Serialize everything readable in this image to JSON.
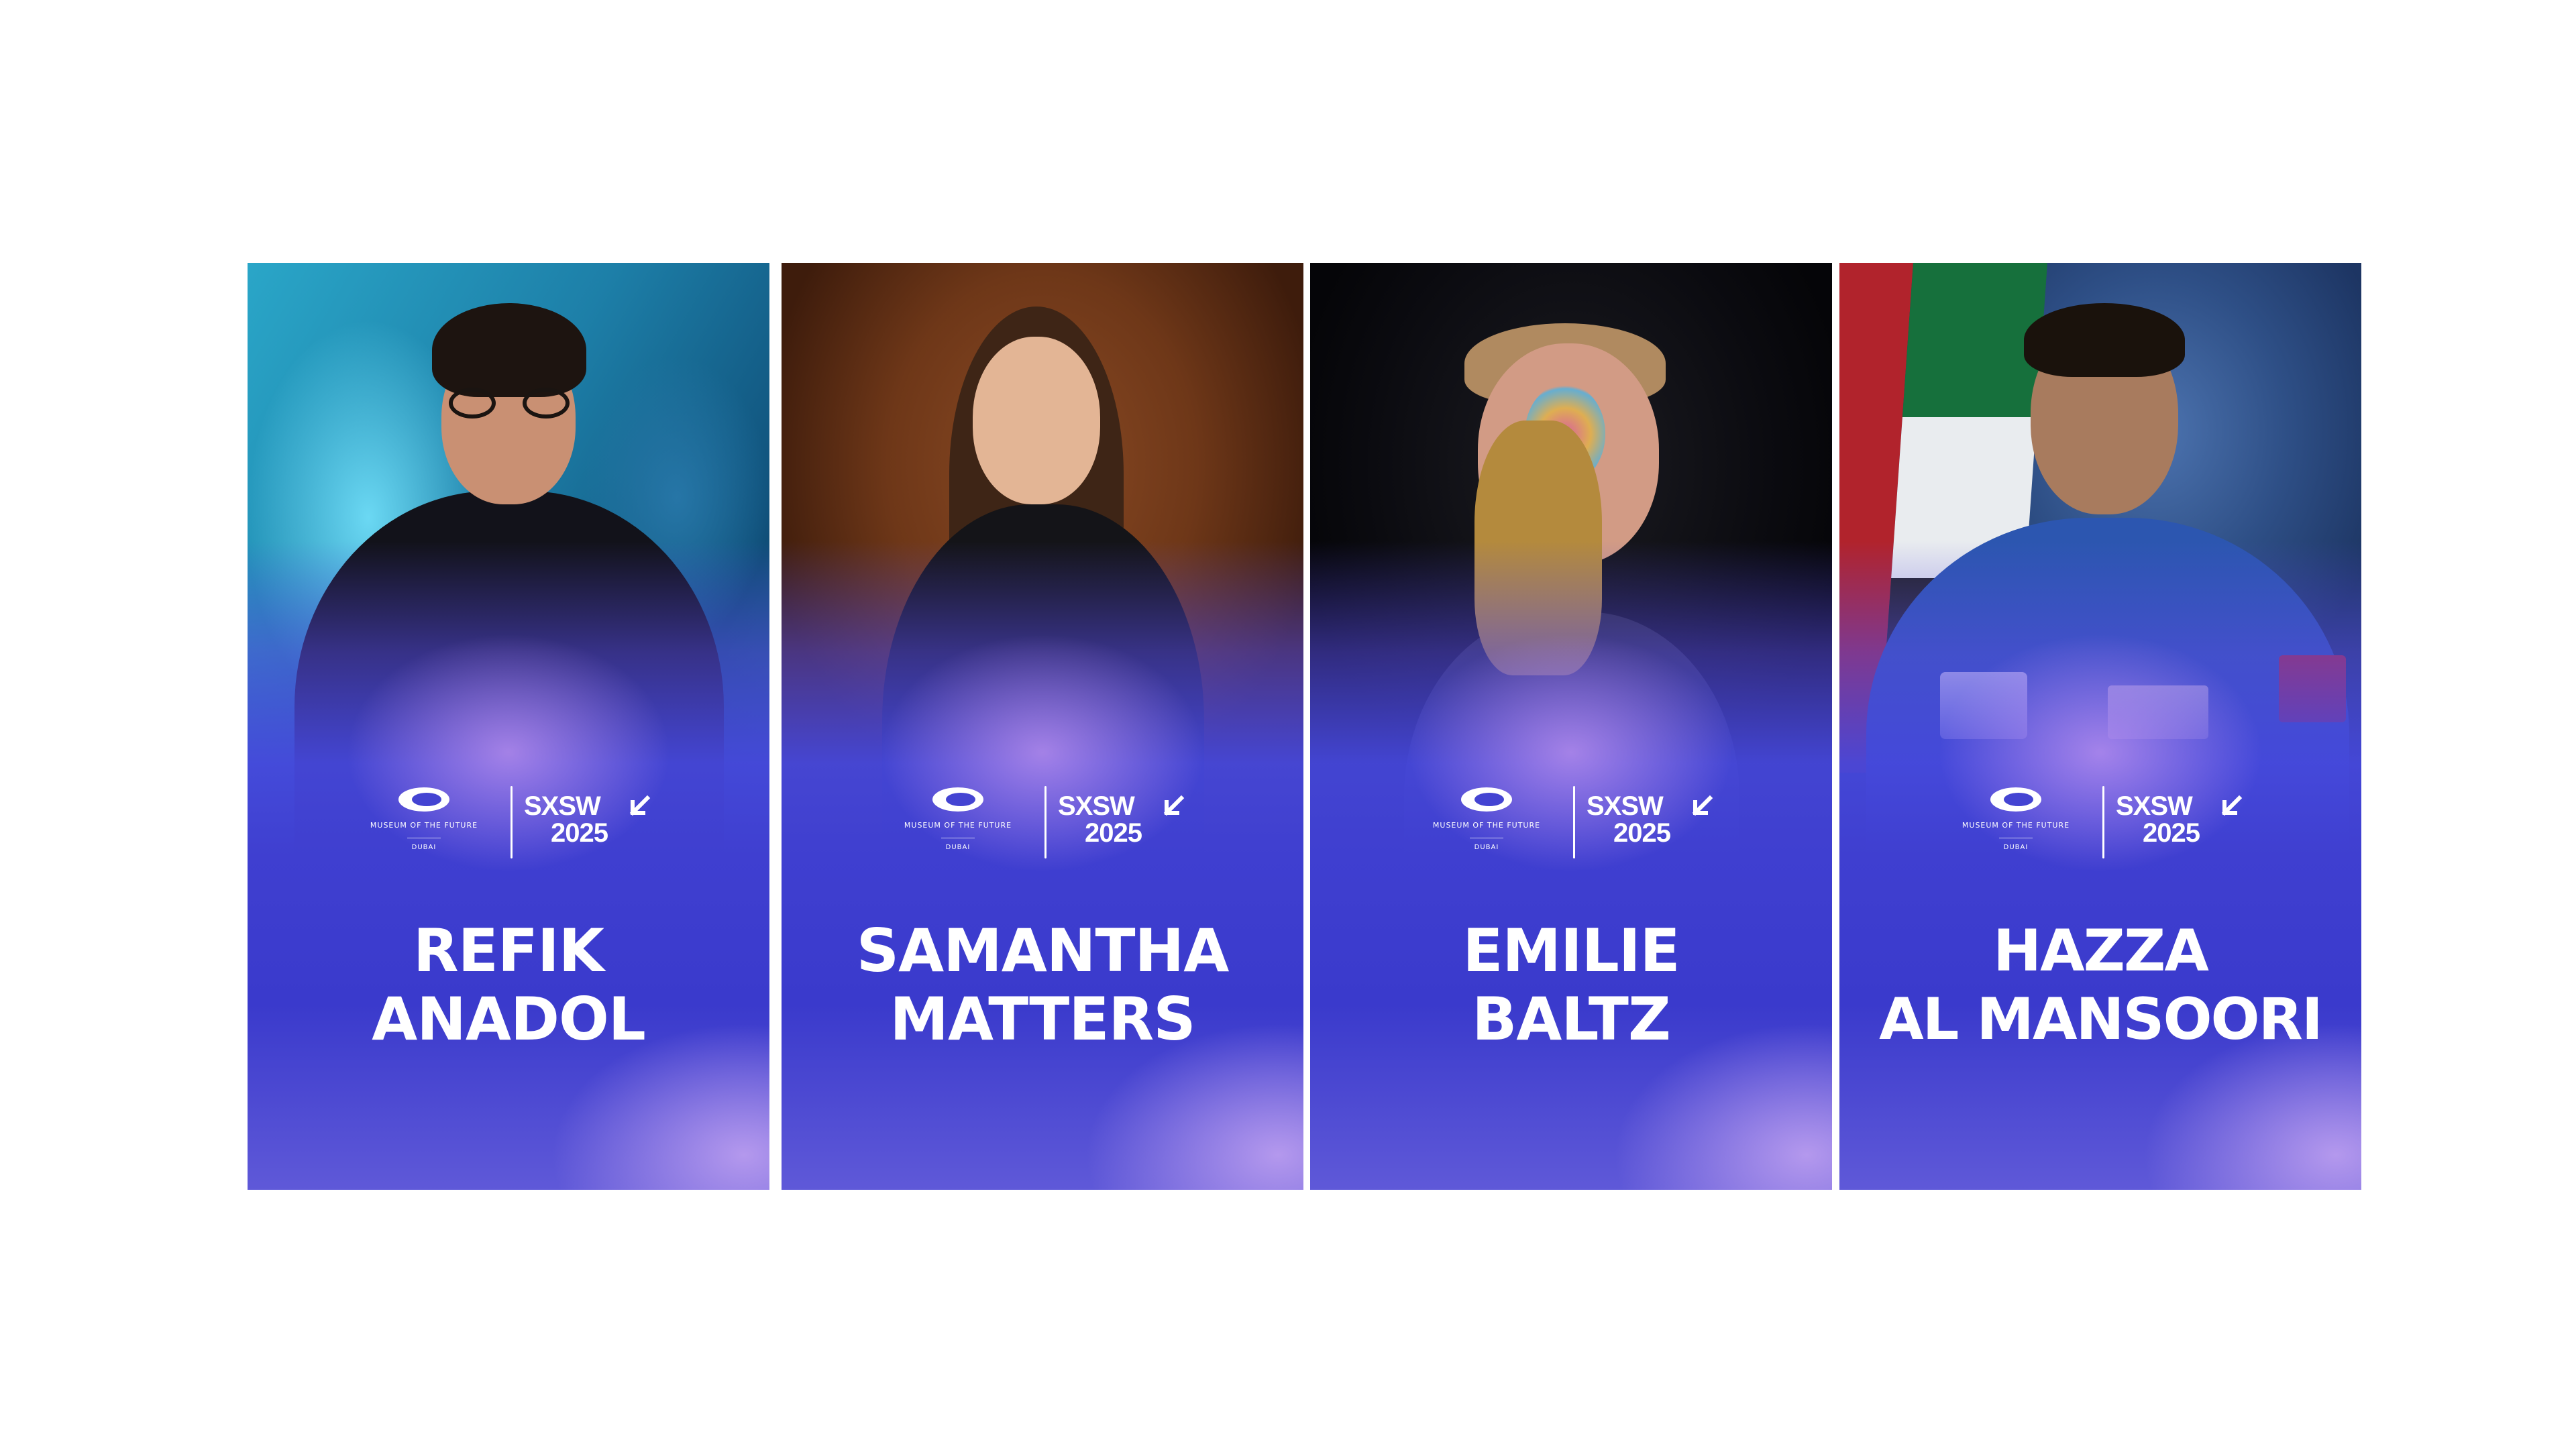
{
  "logos": {
    "museum_name": "MUSEUM OF THE FUTURE",
    "museum_city": "DUBAI",
    "sxsw_name": "SXSW",
    "sxsw_year": "2025"
  },
  "speakers": [
    {
      "first": "REFIK",
      "last": "ANADOL"
    },
    {
      "first": "SAMANTHA",
      "last": "MATTERS"
    },
    {
      "first": "EMILIE",
      "last": "BALTZ"
    },
    {
      "first": "HAZZA",
      "last": "AL MANSOORI"
    }
  ],
  "colors": {
    "card_blue": "#3f3fd0",
    "card_glow": "#c496f0",
    "text": "#ffffff"
  }
}
